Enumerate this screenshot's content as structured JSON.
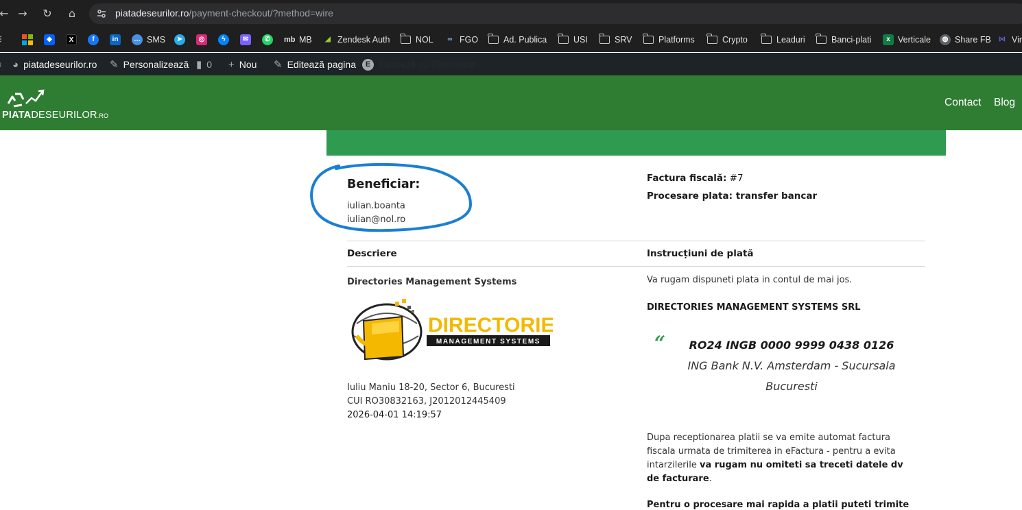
{
  "browser": {
    "url_domain": "piatadeseurilor.ro",
    "url_path": "/payment-checkout/?method=wire",
    "bookmarks": [
      "SMS",
      "MB",
      "Zendesk Auth",
      "NOL",
      "FGO",
      "Ad. Publica",
      "USI",
      "SRV",
      "Platforms",
      "Crypto",
      "Leaduri",
      "Banci-plati",
      "Verticale",
      "Share FB",
      "Vir"
    ]
  },
  "adminbar": {
    "site": "piatadeseurilor.ro",
    "customize": "Personalizează",
    "comments": "0",
    "new": "Nou",
    "edit": "Editează pagina",
    "elementor": "Editează cu Elementor"
  },
  "header": {
    "logo_bold": "PIATA",
    "logo_regular": "DESEURILOR",
    "logo_suffix": ".RO",
    "menu": [
      "Contact",
      "Blog"
    ]
  },
  "invoice": {
    "beneficiary_heading": "Beneficiar:",
    "beneficiary_user": "iulian.boanta",
    "beneficiary_email": "iulian@nol.ro",
    "invoice_label": "Factura fiscală:",
    "invoice_number": "#7",
    "processing_label": "Procesare plata: transfer bancar",
    "col_description": "Descriere",
    "col_instructions": "Instrucțiuni de plată",
    "company_name": "Directories Management Systems",
    "logo_title": "DIRECTORIES",
    "logo_subtitle": "MANAGEMENT SYSTEMS",
    "address": "Iuliu Maniu 18-20, Sector 6, Bucuresti",
    "cui": "CUI RO30832163, J2012012445409",
    "datetime": "2026-04-01 14:19:57",
    "instructions_intro": "Va rugam dispuneti plata in contul de mai jos.",
    "account_holder": "DIRECTORIES MANAGEMENT SYSTEMS SRL",
    "quote_mark": "“",
    "iban": "RO24 INGB 0000 9999 0438 0126",
    "bank_line1": "ING Bank N.V. Amsterdam - Sucursala",
    "bank_line2": "Bucuresti",
    "after_text": "Dupa receptionarea platii se va emite automat factura fiscala urmata de trimiterea in eFactura - pentru a evita intarzilerile",
    "after_bold": "va rugam nu omiteti sa treceti datele dv de facturare",
    "after_end": ".",
    "cut_text": "Pentru o procesare mai rapida a platii puteti trimite"
  },
  "colors": {
    "header_green": "#2e7d32",
    "banner_green": "#2e9b50",
    "annotation_blue": "#1a7fd4",
    "logo_yellow": "#f5b800"
  }
}
